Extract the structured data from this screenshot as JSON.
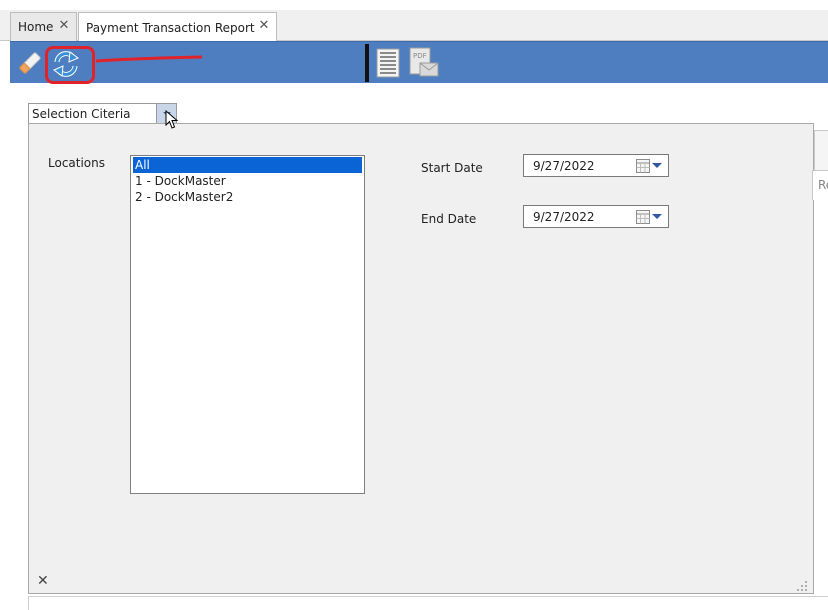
{
  "tabs": [
    {
      "label": "Home",
      "close": "✕"
    },
    {
      "label": "Payment Transaction Report",
      "close": "✕"
    }
  ],
  "toolbar": {
    "icons": [
      "eraser-icon",
      "refresh-icon",
      "report-icon",
      "pdf-email-icon"
    ],
    "pdf_badge": "PDF",
    "annotation_color": "#e0232a",
    "background": "#4e7ec0"
  },
  "selection": {
    "label": "Selection Citeria"
  },
  "form": {
    "locations_label": "Locations",
    "locations": [
      "All",
      "1 - DockMaster",
      "2 - DockMaster2"
    ],
    "selected_index": 0,
    "start_date_label": "Start Date",
    "start_date": "9/27/2022",
    "end_date_label": "End Date",
    "end_date": "9/27/2022"
  },
  "panel": {
    "close": "✕",
    "side_label": "Re"
  },
  "colors": {
    "selected_item": "#0a64d6",
    "toolbar": "#4e7ec0"
  }
}
